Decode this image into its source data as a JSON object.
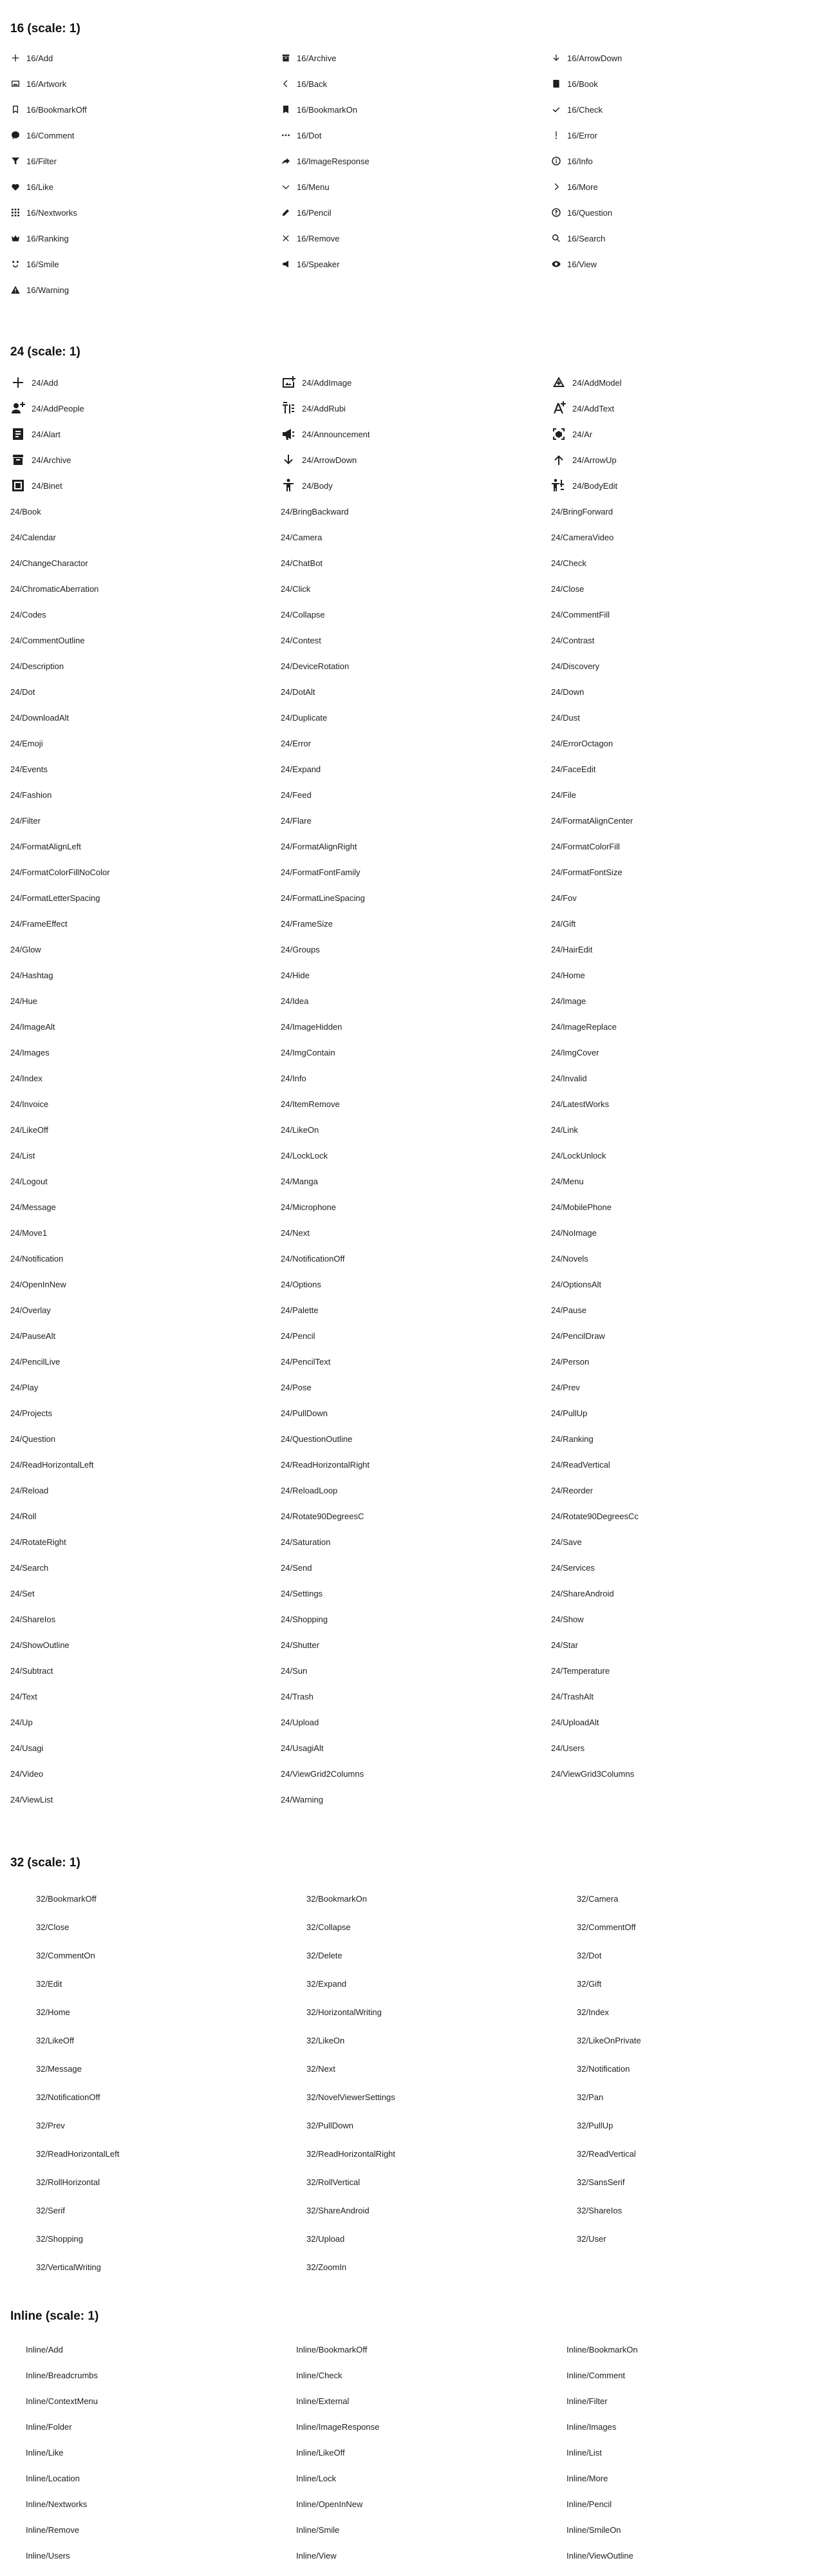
{
  "sections": [
    {
      "title": "16 (scale: 1)",
      "items": [
        {
          "label": "16/Add",
          "icon": "plus"
        },
        {
          "label": "16/Archive",
          "icon": "archive"
        },
        {
          "label": "16/ArrowDown",
          "icon": "arrow-down"
        },
        {
          "label": "16/Artwork",
          "icon": "artwork"
        },
        {
          "label": "16/Back",
          "icon": "chevron-left"
        },
        {
          "label": "16/Book",
          "icon": "book"
        },
        {
          "label": "16/BookmarkOff",
          "icon": "bookmark-outline"
        },
        {
          "label": "16/BookmarkOn",
          "icon": "bookmark"
        },
        {
          "label": "16/Check",
          "icon": "check"
        },
        {
          "label": "16/Comment",
          "icon": "comment"
        },
        {
          "label": "16/Dot",
          "icon": "dots"
        },
        {
          "label": "16/Error",
          "icon": "exclamation"
        },
        {
          "label": "16/Filter",
          "icon": "filter"
        },
        {
          "label": "16/ImageResponse",
          "icon": "share-arrow"
        },
        {
          "label": "16/Info",
          "icon": "info-circle"
        },
        {
          "label": "16/Like",
          "icon": "heart"
        },
        {
          "label": "16/Menu",
          "icon": "chevron-down"
        },
        {
          "label": "16/More",
          "icon": "chevron-right"
        },
        {
          "label": "16/Nextworks",
          "icon": "grid"
        },
        {
          "label": "16/Pencil",
          "icon": "pencil"
        },
        {
          "label": "16/Question",
          "icon": "question-circle"
        },
        {
          "label": "16/Ranking",
          "icon": "crown"
        },
        {
          "label": "16/Remove",
          "icon": "cross"
        },
        {
          "label": "16/Search",
          "icon": "search"
        },
        {
          "label": "16/Smile",
          "icon": "smile"
        },
        {
          "label": "16/Speaker",
          "icon": "speaker"
        },
        {
          "label": "16/View",
          "icon": "eye"
        },
        {
          "label": "16/Warning",
          "icon": "warning"
        }
      ]
    },
    {
      "title": "24 (scale: 1)",
      "items": [
        {
          "label": "24/Add",
          "icon": "plus"
        },
        {
          "label": "24/AddImage",
          "icon": "add-image"
        },
        {
          "label": "24/AddModel",
          "icon": "add-model"
        },
        {
          "label": "24/AddPeople",
          "icon": "add-people"
        },
        {
          "label": "24/AddRubi",
          "icon": "add-rubi"
        },
        {
          "label": "24/AddText",
          "icon": "add-text"
        },
        {
          "label": "24/Alart",
          "icon": "alart"
        },
        {
          "label": "24/Announcement",
          "icon": "megaphone"
        },
        {
          "label": "24/Ar",
          "icon": "ar-frame"
        },
        {
          "label": "24/Archive",
          "icon": "archive"
        },
        {
          "label": "24/ArrowDown",
          "icon": "arrow-down"
        },
        {
          "label": "24/ArrowUp",
          "icon": "arrow-up"
        },
        {
          "label": "24/Binet",
          "icon": "binet"
        },
        {
          "label": "24/Body",
          "icon": "body"
        },
        {
          "label": "24/BodyEdit",
          "icon": "body-edit"
        },
        {
          "label": "24/Book"
        },
        {
          "label": "24/BringBackward"
        },
        {
          "label": "24/BringForward"
        },
        {
          "label": "24/Calendar"
        },
        {
          "label": "24/Camera"
        },
        {
          "label": "24/CameraVideo"
        },
        {
          "label": "24/ChangeCharactor"
        },
        {
          "label": "24/ChatBot"
        },
        {
          "label": "24/Check"
        },
        {
          "label": "24/ChromaticAberration"
        },
        {
          "label": "24/Click"
        },
        {
          "label": "24/Close"
        },
        {
          "label": "24/Codes"
        },
        {
          "label": "24/Collapse"
        },
        {
          "label": "24/CommentFill"
        },
        {
          "label": "24/CommentOutline"
        },
        {
          "label": "24/Contest"
        },
        {
          "label": "24/Contrast"
        },
        {
          "label": "24/Description"
        },
        {
          "label": "24/DeviceRotation"
        },
        {
          "label": "24/Discovery"
        },
        {
          "label": "24/Dot"
        },
        {
          "label": "24/DotAlt"
        },
        {
          "label": "24/Down"
        },
        {
          "label": "24/DownloadAlt"
        },
        {
          "label": "24/Duplicate"
        },
        {
          "label": "24/Dust"
        },
        {
          "label": "24/Emoji"
        },
        {
          "label": "24/Error"
        },
        {
          "label": "24/ErrorOctagon"
        },
        {
          "label": "24/Events"
        },
        {
          "label": "24/Expand"
        },
        {
          "label": "24/FaceEdit"
        },
        {
          "label": "24/Fashion"
        },
        {
          "label": "24/Feed"
        },
        {
          "label": "24/File"
        },
        {
          "label": "24/Filter"
        },
        {
          "label": "24/Flare"
        },
        {
          "label": "24/FormatAlignCenter"
        },
        {
          "label": "24/FormatAlignLeft"
        },
        {
          "label": "24/FormatAlignRight"
        },
        {
          "label": "24/FormatColorFill"
        },
        {
          "label": "24/FormatColorFillNoColor"
        },
        {
          "label": "24/FormatFontFamily"
        },
        {
          "label": "24/FormatFontSize"
        },
        {
          "label": "24/FormatLetterSpacing"
        },
        {
          "label": "24/FormatLineSpacing"
        },
        {
          "label": "24/Fov"
        },
        {
          "label": "24/FrameEffect"
        },
        {
          "label": "24/FrameSize"
        },
        {
          "label": "24/Gift"
        },
        {
          "label": "24/Glow"
        },
        {
          "label": "24/Groups"
        },
        {
          "label": "24/HairEdit"
        },
        {
          "label": "24/Hashtag"
        },
        {
          "label": "24/Hide"
        },
        {
          "label": "24/Home"
        },
        {
          "label": "24/Hue"
        },
        {
          "label": "24/Idea"
        },
        {
          "label": "24/Image"
        },
        {
          "label": "24/ImageAlt"
        },
        {
          "label": "24/ImageHidden"
        },
        {
          "label": "24/ImageReplace"
        },
        {
          "label": "24/Images"
        },
        {
          "label": "24/ImgContain"
        },
        {
          "label": "24/ImgCover"
        },
        {
          "label": "24/Index"
        },
        {
          "label": "24/Info"
        },
        {
          "label": "24/Invalid"
        },
        {
          "label": "24/Invoice"
        },
        {
          "label": "24/ItemRemove"
        },
        {
          "label": "24/LatestWorks"
        },
        {
          "label": "24/LikeOff"
        },
        {
          "label": "24/LikeOn"
        },
        {
          "label": "24/Link"
        },
        {
          "label": "24/List"
        },
        {
          "label": "24/LockLock"
        },
        {
          "label": "24/LockUnlock"
        },
        {
          "label": "24/Logout"
        },
        {
          "label": "24/Manga"
        },
        {
          "label": "24/Menu"
        },
        {
          "label": "24/Message"
        },
        {
          "label": "24/Microphone"
        },
        {
          "label": "24/MobilePhone"
        },
        {
          "label": "24/Move1"
        },
        {
          "label": "24/Next"
        },
        {
          "label": "24/NoImage"
        },
        {
          "label": "24/Notification"
        },
        {
          "label": "24/NotificationOff"
        },
        {
          "label": "24/Novels"
        },
        {
          "label": "24/OpenInNew"
        },
        {
          "label": "24/Options"
        },
        {
          "label": "24/OptionsAlt"
        },
        {
          "label": "24/Overlay"
        },
        {
          "label": "24/Palette"
        },
        {
          "label": "24/Pause"
        },
        {
          "label": "24/PauseAlt"
        },
        {
          "label": "24/Pencil"
        },
        {
          "label": "24/PencilDraw"
        },
        {
          "label": "24/PencilLive"
        },
        {
          "label": "24/PencilText"
        },
        {
          "label": "24/Person"
        },
        {
          "label": "24/Play"
        },
        {
          "label": "24/Pose"
        },
        {
          "label": "24/Prev"
        },
        {
          "label": "24/Projects"
        },
        {
          "label": "24/PullDown"
        },
        {
          "label": "24/PullUp"
        },
        {
          "label": "24/Question"
        },
        {
          "label": "24/QuestionOutline"
        },
        {
          "label": "24/Ranking"
        },
        {
          "label": "24/ReadHorizontalLeft"
        },
        {
          "label": "24/ReadHorizontalRight"
        },
        {
          "label": "24/ReadVertical"
        },
        {
          "label": "24/Reload"
        },
        {
          "label": "24/ReloadLoop"
        },
        {
          "label": "24/Reorder"
        },
        {
          "label": "24/Roll"
        },
        {
          "label": "24/Rotate90DegreesC"
        },
        {
          "label": "24/Rotate90DegreesCc"
        },
        {
          "label": "24/RotateRight"
        },
        {
          "label": "24/Saturation"
        },
        {
          "label": "24/Save"
        },
        {
          "label": "24/Search"
        },
        {
          "label": "24/Send"
        },
        {
          "label": "24/Services"
        },
        {
          "label": "24/Set"
        },
        {
          "label": "24/Settings"
        },
        {
          "label": "24/ShareAndroid"
        },
        {
          "label": "24/ShareIos"
        },
        {
          "label": "24/Shopping"
        },
        {
          "label": "24/Show"
        },
        {
          "label": "24/ShowOutline"
        },
        {
          "label": "24/Shutter"
        },
        {
          "label": "24/Star"
        },
        {
          "label": "24/Subtract"
        },
        {
          "label": "24/Sun"
        },
        {
          "label": "24/Temperature"
        },
        {
          "label": "24/Text"
        },
        {
          "label": "24/Trash"
        },
        {
          "label": "24/TrashAlt"
        },
        {
          "label": "24/Up"
        },
        {
          "label": "24/Upload"
        },
        {
          "label": "24/UploadAlt"
        },
        {
          "label": "24/Usagi"
        },
        {
          "label": "24/UsagiAlt"
        },
        {
          "label": "24/Users"
        },
        {
          "label": "24/Video"
        },
        {
          "label": "24/ViewGrid2Columns"
        },
        {
          "label": "24/ViewGrid3Columns"
        },
        {
          "label": "24/ViewList"
        },
        {
          "label": "24/Warning"
        }
      ]
    },
    {
      "title": "32 (scale: 1)",
      "items": [
        {
          "label": "32/BookmarkOff"
        },
        {
          "label": "32/BookmarkOn"
        },
        {
          "label": "32/Camera"
        },
        {
          "label": "32/Close"
        },
        {
          "label": "32/Collapse"
        },
        {
          "label": "32/CommentOff"
        },
        {
          "label": "32/CommentOn"
        },
        {
          "label": "32/Delete"
        },
        {
          "label": "32/Dot"
        },
        {
          "label": "32/Edit"
        },
        {
          "label": "32/Expand"
        },
        {
          "label": "32/Gift"
        },
        {
          "label": "32/Home"
        },
        {
          "label": "32/HorizontalWriting"
        },
        {
          "label": "32/Index"
        },
        {
          "label": "32/LikeOff"
        },
        {
          "label": "32/LikeOn"
        },
        {
          "label": "32/LikeOnPrivate"
        },
        {
          "label": "32/Message"
        },
        {
          "label": "32/Next"
        },
        {
          "label": "32/Notification"
        },
        {
          "label": "32/NotificationOff"
        },
        {
          "label": "32/NovelViewerSettings"
        },
        {
          "label": "32/Pan"
        },
        {
          "label": "32/Prev"
        },
        {
          "label": "32/PullDown"
        },
        {
          "label": "32/PullUp"
        },
        {
          "label": "32/ReadHorizontalLeft"
        },
        {
          "label": "32/ReadHorizontalRight"
        },
        {
          "label": "32/ReadVertical"
        },
        {
          "label": "32/RollHorizontal"
        },
        {
          "label": "32/RollVertical"
        },
        {
          "label": "32/SansSerif"
        },
        {
          "label": "32/Serif"
        },
        {
          "label": "32/ShareAndroid"
        },
        {
          "label": "32/ShareIos"
        },
        {
          "label": "32/Shopping"
        },
        {
          "label": "32/Upload"
        },
        {
          "label": "32/User"
        },
        {
          "label": "32/VerticalWriting"
        },
        {
          "label": "32/ZoomIn"
        }
      ]
    },
    {
      "title": "Inline (scale: 1)",
      "items": [
        {
          "label": "Inline/Add"
        },
        {
          "label": "Inline/BookmarkOff"
        },
        {
          "label": "Inline/BookmarkOn"
        },
        {
          "label": "Inline/Breadcrumbs"
        },
        {
          "label": "Inline/Check"
        },
        {
          "label": "Inline/Comment"
        },
        {
          "label": "Inline/ContextMenu"
        },
        {
          "label": "Inline/External"
        },
        {
          "label": "Inline/Filter"
        },
        {
          "label": "Inline/Folder"
        },
        {
          "label": "Inline/ImageResponse"
        },
        {
          "label": "Inline/Images"
        },
        {
          "label": "Inline/Like"
        },
        {
          "label": "Inline/LikeOff"
        },
        {
          "label": "Inline/List"
        },
        {
          "label": "Inline/Location"
        },
        {
          "label": "Inline/Lock"
        },
        {
          "label": "Inline/More"
        },
        {
          "label": "Inline/Nextworks"
        },
        {
          "label": "Inline/OpenInNew"
        },
        {
          "label": "Inline/Pencil"
        },
        {
          "label": "Inline/Remove"
        },
        {
          "label": "Inline/Smile"
        },
        {
          "label": "Inline/SmileOn"
        },
        {
          "label": "Inline/Users"
        },
        {
          "label": "Inline/View"
        },
        {
          "label": "Inline/ViewOutline"
        }
      ]
    }
  ]
}
